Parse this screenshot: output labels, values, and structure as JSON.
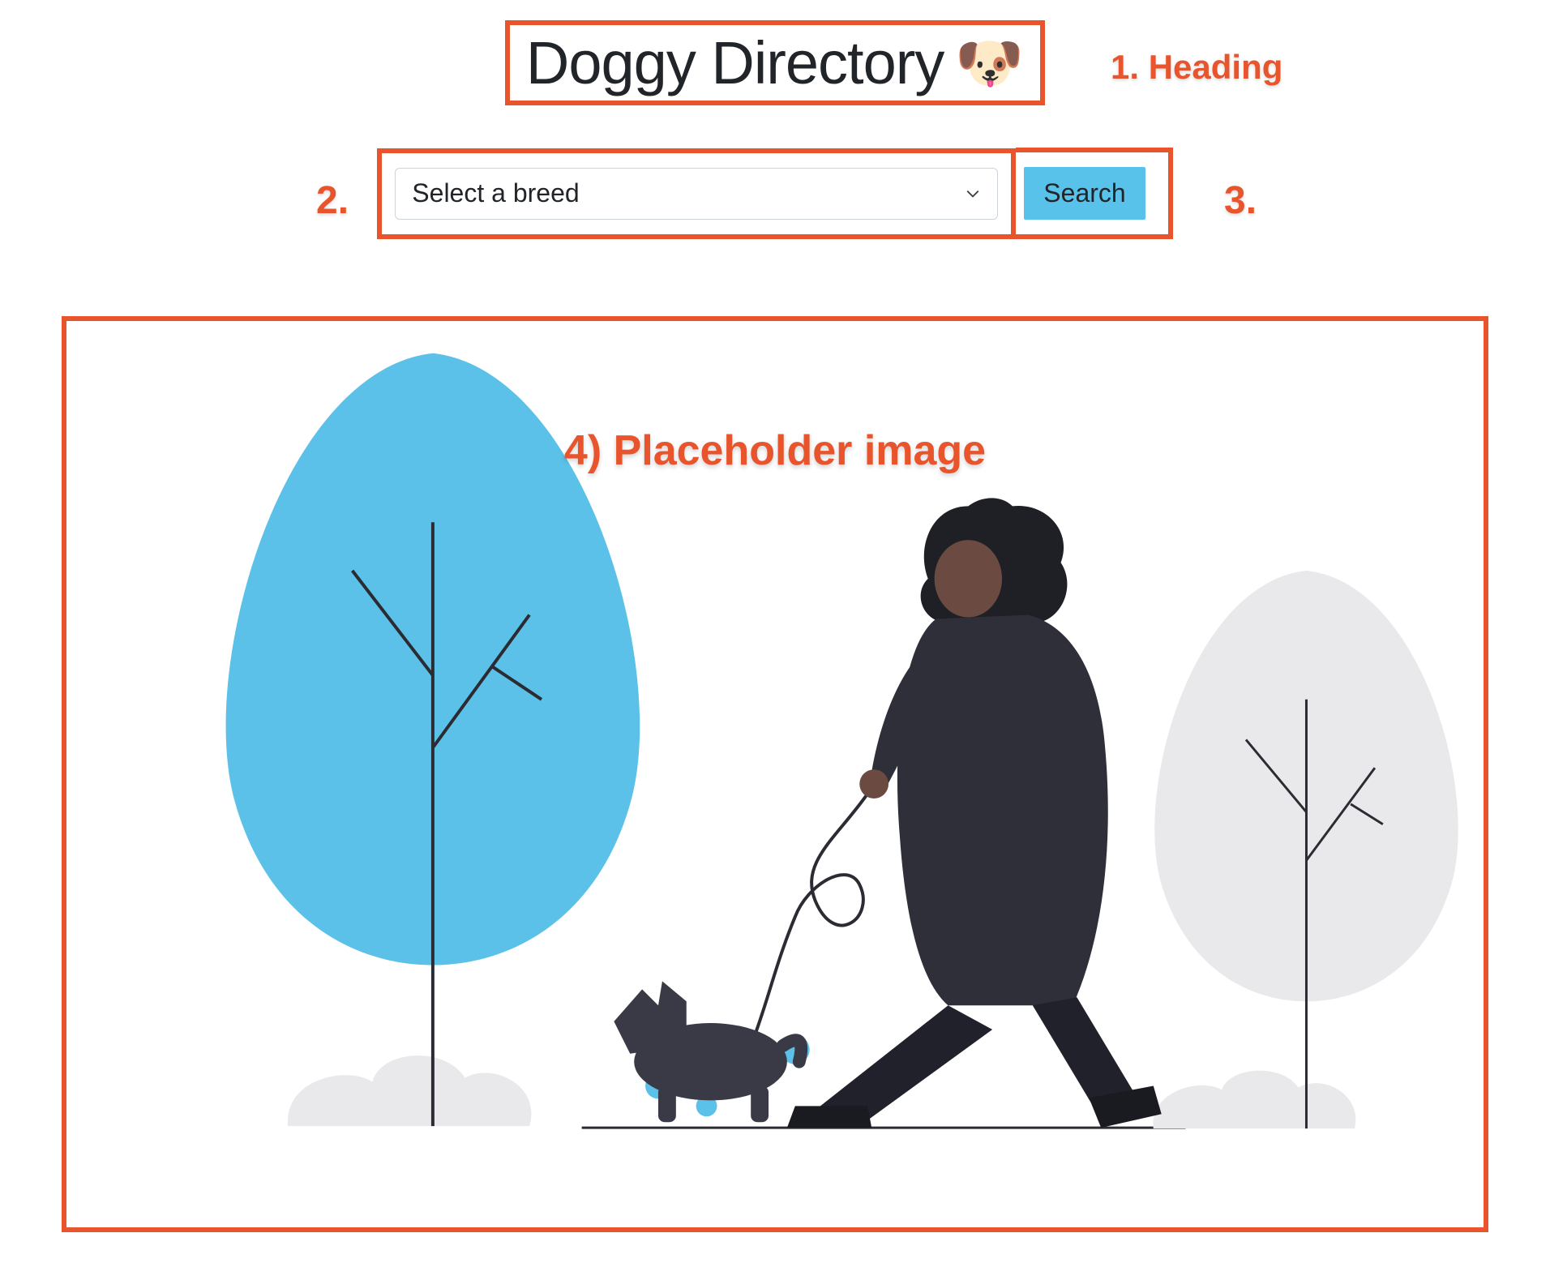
{
  "heading": {
    "title": "Doggy Directory",
    "emoji": "🐶"
  },
  "search": {
    "select_placeholder": "Select a breed",
    "button_label": "Search"
  },
  "annotations": {
    "a1": "1. Heading",
    "a2": "2.",
    "a3": "3.",
    "a4": "4) Placeholder image"
  }
}
